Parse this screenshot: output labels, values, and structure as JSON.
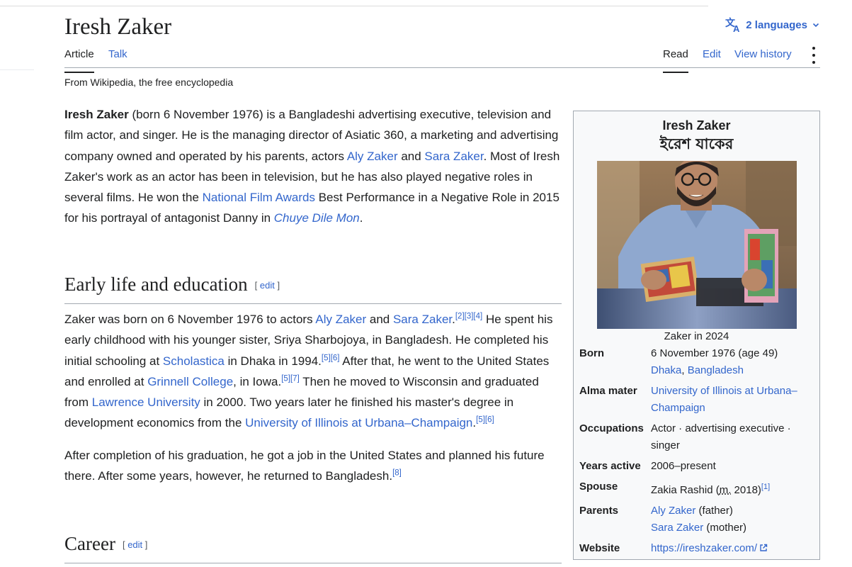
{
  "header": {
    "title": "Iresh Zaker",
    "languages_label": "2 languages"
  },
  "tabs": {
    "article": "Article",
    "talk": "Talk",
    "read": "Read",
    "edit": "Edit",
    "view_history": "View history"
  },
  "tagline": "From Wikipedia, the free encyclopedia",
  "lead": {
    "name_bold": "Iresh Zaker",
    "t1": " (born 6 November 1976) is a Bangladeshi advertising executive, television and film actor, and singer. He is the managing director of Asiatic 360, a marketing and advertising company owned and operated by his parents, actors ",
    "link_aly": "Aly Zaker",
    "t2": " and ",
    "link_sara": "Sara Zaker",
    "t3": ". Most of Iresh Zaker's work as an actor has been in television, but he has also played negative roles in several films. He won the ",
    "link_nfa": "National Film Awards",
    "t4": " Best Performance in a Negative Role in 2015 for his portrayal of antagonist Danny in ",
    "link_film": "Chuye Dile Mon",
    "t5": "."
  },
  "sections": {
    "early_title": "Early life and education",
    "career_title": "Career",
    "edit_open": "[ ",
    "edit_label": "edit",
    "edit_close": " ]"
  },
  "early": {
    "p1": {
      "t1": "Zaker was born on 6 November 1976 to actors ",
      "link_aly": "Aly Zaker",
      "t2": " and ",
      "link_sara": "Sara Zaker",
      "t3": ".",
      "ref_a": "[2][3][4]",
      "t4": " He spent his early childhood with his younger sister, Sriya Sharbojoya, in Bangladesh. He completed his initial schooling at ",
      "link_scholastica": "Scholastica",
      "t5": " in Dhaka in 1994.",
      "ref_b": "[5][6]",
      "t6": " After that, he went to the United States and enrolled at ",
      "link_grinnell": "Grinnell College",
      "t7": ", in Iowa.",
      "ref_c": "[5][7]",
      "t8": " Then he moved to Wisconsin and graduated from ",
      "link_lawrence": "Lawrence University",
      "t9": " in 2000. Two years later he finished his master's degree in development economics from the ",
      "link_uiuc": "University of Illinois at Urbana–Champaign",
      "t10": ".",
      "ref_d": "[5][6]"
    },
    "p2": {
      "t1": "After completion of his graduation, he got a job in the United States and planned his future there. After some years, however, he returned to Bangladesh.",
      "ref": "[8]"
    }
  },
  "infobox": {
    "name": "Iresh Zaker",
    "native_name": "ইরেশ যাকের",
    "caption": "Zaker in 2024",
    "born_label": "Born",
    "born_date": "6 November 1976 (age 49)",
    "born_city": "Dhaka",
    "born_sep": ", ",
    "born_country": "Bangladesh",
    "alma_label": "Alma mater",
    "alma_value": "University of Illinois at Urbana–Champaign",
    "occ_label": "Occupations",
    "occ_value": "Actor · advertising executive · singer",
    "years_label": "Years active",
    "years_value": "2006–present",
    "spouse_label": "Spouse",
    "spouse_name": "Zakia Rashid (",
    "spouse_m": "m.",
    "spouse_year": " 2018)",
    "spouse_ref": "[1]",
    "parents_label": "Parents",
    "parent1": "Aly Zaker",
    "parent1_role": " (father)",
    "parent2": "Sara Zaker",
    "parent2_role": " (mother)",
    "website_label": "Website",
    "website_value": "https://ireshzaker.com/"
  },
  "colors": {
    "link": "#3366cc",
    "text": "#202122",
    "border": "#a2a9b1",
    "infobox_bg": "#f8f9fa"
  },
  "icons": [
    "translate-icon",
    "chevron-down-icon",
    "kebab-menu-icon",
    "external-link-icon"
  ]
}
